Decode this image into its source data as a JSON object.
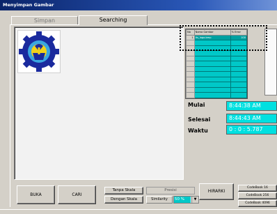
{
  "window": {
    "title": "Menyimpan Gambar"
  },
  "tabs": [
    {
      "label": "Simpan",
      "active": false
    },
    {
      "label": "Searching",
      "active": true
    }
  ],
  "results_table": {
    "columns": [
      "No",
      "Nama Gambar",
      "% Error"
    ],
    "rows": [
      {
        "no": "1",
        "name": "its_logo.bmp",
        "error": "100"
      }
    ],
    "empty_rows": 11
  },
  "timing": {
    "mulai_label": "Mulai",
    "mulai_value": "8:44:38 AM",
    "selesai_label": "Selesai",
    "selesai_value": "8:44:43 AM",
    "waktu_label": "Waktu",
    "waktu_value": "0 : 0 : 5.787"
  },
  "buttons": {
    "buka": "BUKA",
    "cari": "CARI",
    "tanpa_skala": "Tanpa Skala",
    "dengan_skala": "Dengan Skala",
    "hirarki": "HIRARKI",
    "codebook16": "CodeBook 16",
    "codebook256": "CodeBook 256",
    "codebook4096": "CodeBook 4096"
  },
  "presisi": {
    "label": "Presisi"
  },
  "similarity": {
    "label": "Similarity",
    "value": "50 %"
  },
  "colors": {
    "accent": "#00c8c8",
    "title_bar": "#0a246a",
    "face": "#d4d0c8"
  },
  "icons": {
    "logo": "its-logo-gear-icon"
  }
}
